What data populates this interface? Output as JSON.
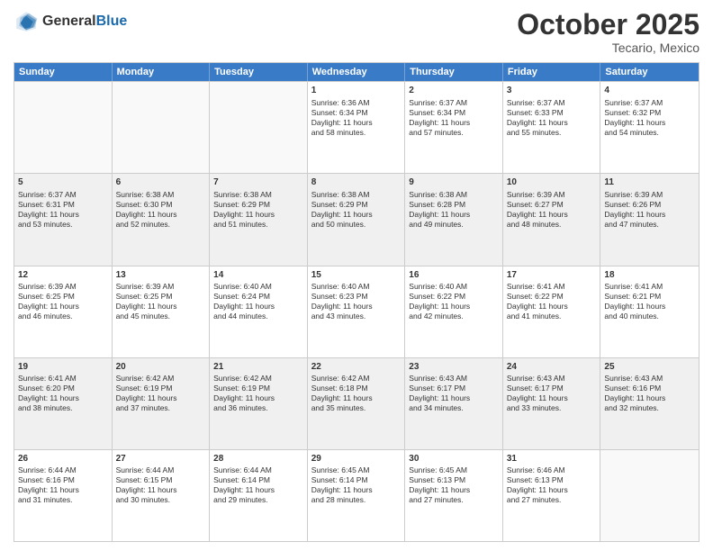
{
  "header": {
    "logo_general": "General",
    "logo_blue": "Blue",
    "month": "October 2025",
    "location": "Tecario, Mexico"
  },
  "days_of_week": [
    "Sunday",
    "Monday",
    "Tuesday",
    "Wednesday",
    "Thursday",
    "Friday",
    "Saturday"
  ],
  "weeks": [
    [
      {
        "day": "",
        "info": "",
        "empty": true
      },
      {
        "day": "",
        "info": "",
        "empty": true
      },
      {
        "day": "",
        "info": "",
        "empty": true
      },
      {
        "day": "1",
        "info": "Sunrise: 6:36 AM\nSunset: 6:34 PM\nDaylight: 11 hours\nand 58 minutes.",
        "empty": false
      },
      {
        "day": "2",
        "info": "Sunrise: 6:37 AM\nSunset: 6:34 PM\nDaylight: 11 hours\nand 57 minutes.",
        "empty": false
      },
      {
        "day": "3",
        "info": "Sunrise: 6:37 AM\nSunset: 6:33 PM\nDaylight: 11 hours\nand 55 minutes.",
        "empty": false
      },
      {
        "day": "4",
        "info": "Sunrise: 6:37 AM\nSunset: 6:32 PM\nDaylight: 11 hours\nand 54 minutes.",
        "empty": false
      }
    ],
    [
      {
        "day": "5",
        "info": "Sunrise: 6:37 AM\nSunset: 6:31 PM\nDaylight: 11 hours\nand 53 minutes.",
        "empty": false
      },
      {
        "day": "6",
        "info": "Sunrise: 6:38 AM\nSunset: 6:30 PM\nDaylight: 11 hours\nand 52 minutes.",
        "empty": false
      },
      {
        "day": "7",
        "info": "Sunrise: 6:38 AM\nSunset: 6:29 PM\nDaylight: 11 hours\nand 51 minutes.",
        "empty": false
      },
      {
        "day": "8",
        "info": "Sunrise: 6:38 AM\nSunset: 6:29 PM\nDaylight: 11 hours\nand 50 minutes.",
        "empty": false
      },
      {
        "day": "9",
        "info": "Sunrise: 6:38 AM\nSunset: 6:28 PM\nDaylight: 11 hours\nand 49 minutes.",
        "empty": false
      },
      {
        "day": "10",
        "info": "Sunrise: 6:39 AM\nSunset: 6:27 PM\nDaylight: 11 hours\nand 48 minutes.",
        "empty": false
      },
      {
        "day": "11",
        "info": "Sunrise: 6:39 AM\nSunset: 6:26 PM\nDaylight: 11 hours\nand 47 minutes.",
        "empty": false
      }
    ],
    [
      {
        "day": "12",
        "info": "Sunrise: 6:39 AM\nSunset: 6:25 PM\nDaylight: 11 hours\nand 46 minutes.",
        "empty": false
      },
      {
        "day": "13",
        "info": "Sunrise: 6:39 AM\nSunset: 6:25 PM\nDaylight: 11 hours\nand 45 minutes.",
        "empty": false
      },
      {
        "day": "14",
        "info": "Sunrise: 6:40 AM\nSunset: 6:24 PM\nDaylight: 11 hours\nand 44 minutes.",
        "empty": false
      },
      {
        "day": "15",
        "info": "Sunrise: 6:40 AM\nSunset: 6:23 PM\nDaylight: 11 hours\nand 43 minutes.",
        "empty": false
      },
      {
        "day": "16",
        "info": "Sunrise: 6:40 AM\nSunset: 6:22 PM\nDaylight: 11 hours\nand 42 minutes.",
        "empty": false
      },
      {
        "day": "17",
        "info": "Sunrise: 6:41 AM\nSunset: 6:22 PM\nDaylight: 11 hours\nand 41 minutes.",
        "empty": false
      },
      {
        "day": "18",
        "info": "Sunrise: 6:41 AM\nSunset: 6:21 PM\nDaylight: 11 hours\nand 40 minutes.",
        "empty": false
      }
    ],
    [
      {
        "day": "19",
        "info": "Sunrise: 6:41 AM\nSunset: 6:20 PM\nDaylight: 11 hours\nand 38 minutes.",
        "empty": false
      },
      {
        "day": "20",
        "info": "Sunrise: 6:42 AM\nSunset: 6:19 PM\nDaylight: 11 hours\nand 37 minutes.",
        "empty": false
      },
      {
        "day": "21",
        "info": "Sunrise: 6:42 AM\nSunset: 6:19 PM\nDaylight: 11 hours\nand 36 minutes.",
        "empty": false
      },
      {
        "day": "22",
        "info": "Sunrise: 6:42 AM\nSunset: 6:18 PM\nDaylight: 11 hours\nand 35 minutes.",
        "empty": false
      },
      {
        "day": "23",
        "info": "Sunrise: 6:43 AM\nSunset: 6:17 PM\nDaylight: 11 hours\nand 34 minutes.",
        "empty": false
      },
      {
        "day": "24",
        "info": "Sunrise: 6:43 AM\nSunset: 6:17 PM\nDaylight: 11 hours\nand 33 minutes.",
        "empty": false
      },
      {
        "day": "25",
        "info": "Sunrise: 6:43 AM\nSunset: 6:16 PM\nDaylight: 11 hours\nand 32 minutes.",
        "empty": false
      }
    ],
    [
      {
        "day": "26",
        "info": "Sunrise: 6:44 AM\nSunset: 6:16 PM\nDaylight: 11 hours\nand 31 minutes.",
        "empty": false
      },
      {
        "day": "27",
        "info": "Sunrise: 6:44 AM\nSunset: 6:15 PM\nDaylight: 11 hours\nand 30 minutes.",
        "empty": false
      },
      {
        "day": "28",
        "info": "Sunrise: 6:44 AM\nSunset: 6:14 PM\nDaylight: 11 hours\nand 29 minutes.",
        "empty": false
      },
      {
        "day": "29",
        "info": "Sunrise: 6:45 AM\nSunset: 6:14 PM\nDaylight: 11 hours\nand 28 minutes.",
        "empty": false
      },
      {
        "day": "30",
        "info": "Sunrise: 6:45 AM\nSunset: 6:13 PM\nDaylight: 11 hours\nand 27 minutes.",
        "empty": false
      },
      {
        "day": "31",
        "info": "Sunrise: 6:46 AM\nSunset: 6:13 PM\nDaylight: 11 hours\nand 27 minutes.",
        "empty": false
      },
      {
        "day": "",
        "info": "",
        "empty": true
      }
    ]
  ]
}
